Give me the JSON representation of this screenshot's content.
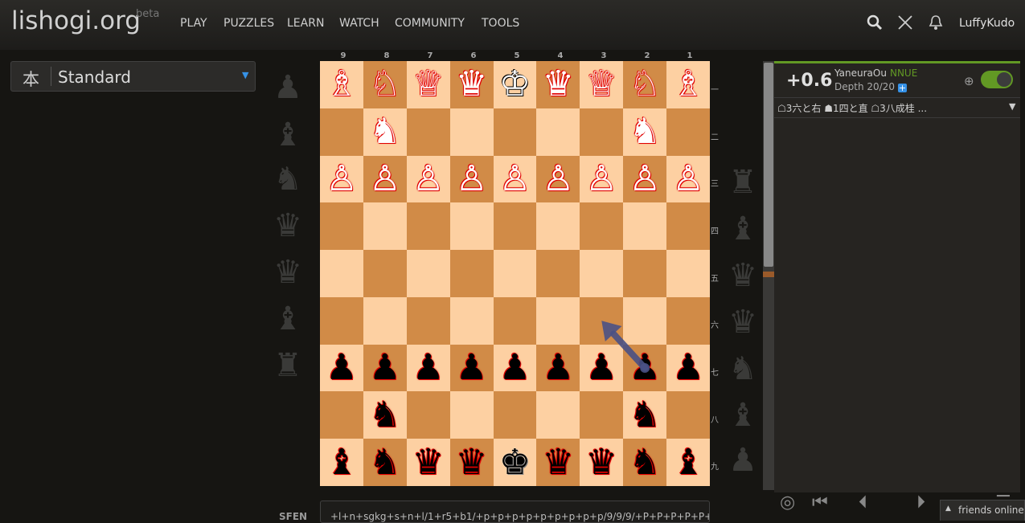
{
  "header": {
    "logo": "lishogi.org",
    "badge": "beta",
    "nav": [
      "PLAY",
      "PUZZLES",
      "LEARN",
      "WATCH",
      "COMMUNITY",
      "TOOLS"
    ],
    "username": "LuffyKudo"
  },
  "variant": {
    "icon": "本",
    "label": "Standard"
  },
  "board": {
    "files": [
      "9",
      "8",
      "7",
      "6",
      "5",
      "4",
      "3",
      "2",
      "1"
    ],
    "ranks": [
      "一",
      "二",
      "三",
      "四",
      "五",
      "六",
      "七",
      "八",
      "九"
    ],
    "rows": [
      [
        [
          "♗",
          "g"
        ],
        [
          "♘",
          "g"
        ],
        [
          "♕",
          "g"
        ],
        [
          "♛",
          "g"
        ],
        [
          "♔",
          "g"
        ],
        [
          "♛",
          "g"
        ],
        [
          "♕",
          "g"
        ],
        [
          "♘",
          "g"
        ],
        [
          "♗",
          "g"
        ]
      ],
      [
        null,
        [
          "♞",
          "g"
        ],
        null,
        null,
        null,
        null,
        null,
        [
          "♞",
          "g"
        ],
        null
      ],
      [
        [
          "♙",
          "g"
        ],
        [
          "♙",
          "g"
        ],
        [
          "♙",
          "g"
        ],
        [
          "♙",
          "g"
        ],
        [
          "♙",
          "g"
        ],
        [
          "♙",
          "g"
        ],
        [
          "♙",
          "g"
        ],
        [
          "♙",
          "g"
        ],
        [
          "♙",
          "g"
        ]
      ],
      [
        null,
        null,
        null,
        null,
        null,
        null,
        null,
        null,
        null
      ],
      [
        null,
        null,
        null,
        null,
        null,
        null,
        null,
        null,
        null
      ],
      [
        null,
        null,
        null,
        null,
        null,
        null,
        null,
        null,
        null
      ],
      [
        [
          "♟",
          "s"
        ],
        [
          "♟",
          "s"
        ],
        [
          "♟",
          "s"
        ],
        [
          "♟",
          "s"
        ],
        [
          "♟",
          "s"
        ],
        [
          "♟",
          "s"
        ],
        [
          "♟",
          "s"
        ],
        [
          "♟",
          "s"
        ],
        [
          "♟",
          "s"
        ]
      ],
      [
        null,
        [
          "♞",
          "s"
        ],
        null,
        null,
        null,
        null,
        null,
        [
          "♞",
          "s"
        ],
        null
      ],
      [
        [
          "♝",
          "s"
        ],
        [
          "♞",
          "s"
        ],
        [
          "♛",
          "s"
        ],
        [
          "♛",
          "s"
        ],
        [
          "♚",
          "s"
        ],
        [
          "♛",
          "s"
        ],
        [
          "♛",
          "s"
        ],
        [
          "♞",
          "s"
        ],
        [
          "♝",
          "s"
        ]
      ]
    ],
    "arrow": {
      "from": "2g",
      "to": "3f",
      "color": "#4a5185"
    }
  },
  "spare_left": [
    "pawn-icon",
    "lance-icon",
    "knight-icon",
    "silver-icon",
    "gold-icon",
    "bishop-icon",
    "rook-icon"
  ],
  "ceval": {
    "score": "+0.6",
    "engine": "YaneuraOu",
    "engine_tag": "NNUE",
    "depth": "Depth 20/20",
    "pv": "☖3六と右 ☗1四と直 ☖3八成桂 ...",
    "accent": "#629924"
  },
  "sfen": {
    "label": "SFEN",
    "value": "+l+n+sgkg+s+n+l/1+r5+b1/+p+p+p+p+p+p+p+p+p/9/9/9/+P+P+P+P+P+"
  },
  "friends": {
    "label": "friends online"
  }
}
